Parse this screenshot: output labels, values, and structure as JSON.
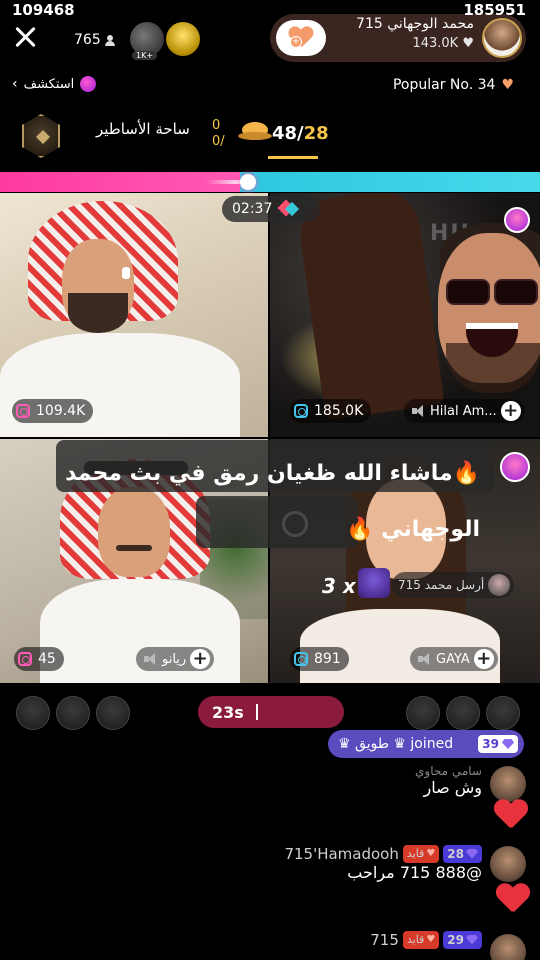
{
  "top": {
    "viewer_count": "765",
    "gift_a_label": "1K+",
    "host_name": "محمد الوجهاني 715",
    "host_likes": "143.0K",
    "explore_label": "استكشف",
    "popular_label": "Popular No. 34"
  },
  "battle": {
    "arena_label": "ساحة الأساطير",
    "mini_score_top": "0",
    "mini_score_bottom": "0/",
    "round_current": "48/",
    "round_total": "28",
    "left_score": "109468",
    "right_score": "185951",
    "timer": "02:37"
  },
  "tiles": {
    "t1": {
      "gift_count": "109.4K"
    },
    "t2": {
      "gift_count": "185.0K",
      "name": "Hilal Am...",
      "banner": "HILAL"
    },
    "t3": {
      "gift_count": "45",
      "name": "ريانو"
    },
    "t4": {
      "gift_count": "891",
      "name": "GAYA",
      "gift_sender": "أرسل محمد 715",
      "combo": "3 x"
    }
  },
  "announcement": {
    "text": "🔥ماشاء الله ظغيان رمق في بث محمد الوجهاني 🔥"
  },
  "bottom": {
    "countdown": "23s",
    "joined_level": "39",
    "joined_text": "♛ طويق ♛ joined"
  },
  "comments": [
    {
      "name": "سامي محاوي",
      "text": "وش صار"
    },
    {
      "name": "715'Hamadooh",
      "level": "28",
      "fan_label": "قايد",
      "text": "@888 715 مراحب"
    },
    {
      "name": "715",
      "level": "29",
      "fan_label": "قايد",
      "text": ""
    }
  ],
  "colors": {
    "left_team": "#ff3aa0",
    "right_team": "#2ec7e0",
    "countdown_bg": "#8a1b3c",
    "joined_bg": "#5a4bbf",
    "heart": "#e8323e"
  }
}
